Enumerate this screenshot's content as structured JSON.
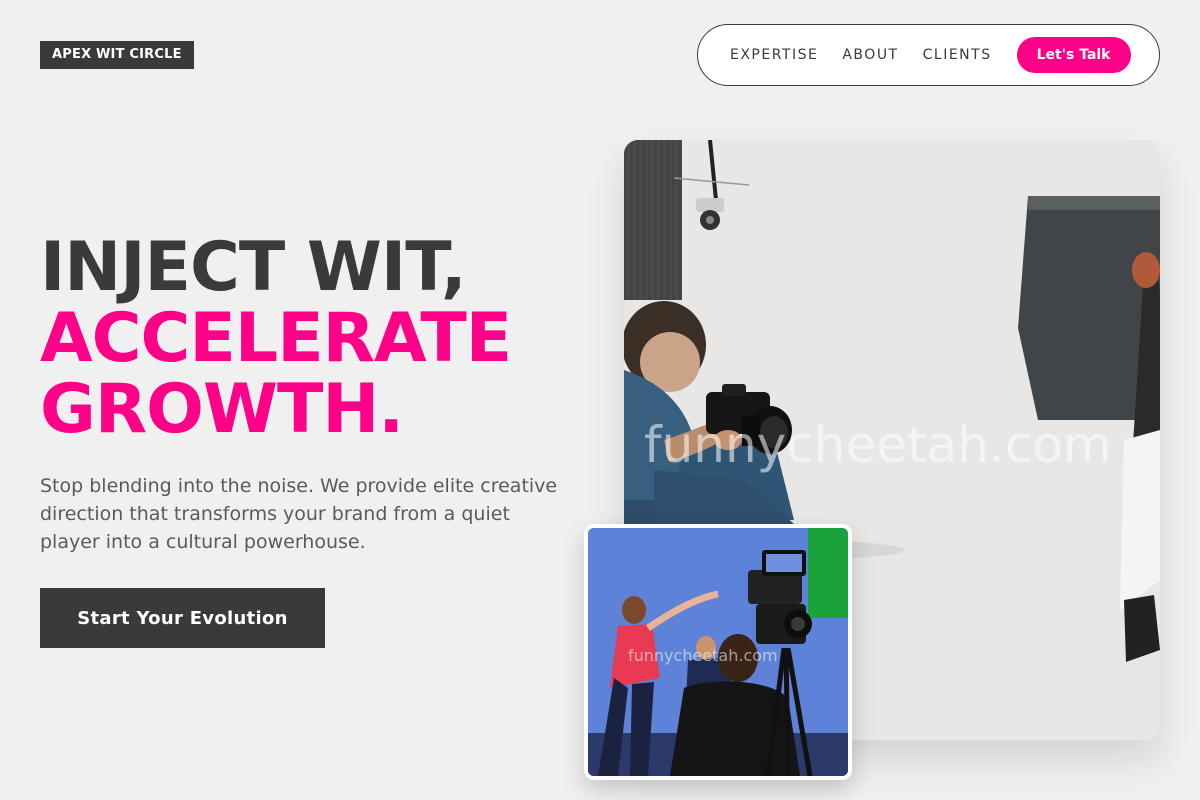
{
  "brand": {
    "logo_text": "APEX WIT CIRCLE"
  },
  "nav": {
    "items": [
      {
        "label": "EXPERTISE"
      },
      {
        "label": "ABOUT"
      },
      {
        "label": "CLIENTS"
      }
    ],
    "cta_label": "Let's Talk"
  },
  "hero": {
    "title_line1": "INJECT WIT,",
    "title_line2": "ACCELERATE",
    "title_line3": "GROWTH.",
    "subtitle": "Stop blending into the noise. We provide elite creative direction that transforms your brand from a quiet player into a cultural powerhouse.",
    "button_label": "Start Your Evolution"
  },
  "images": {
    "main_watermark": "funnycheetah.com",
    "small_watermark": "funnycheetah.com"
  },
  "colors": {
    "accent": "#ff0088",
    "dark": "#3a3a3a",
    "background": "#f0f0f0"
  }
}
